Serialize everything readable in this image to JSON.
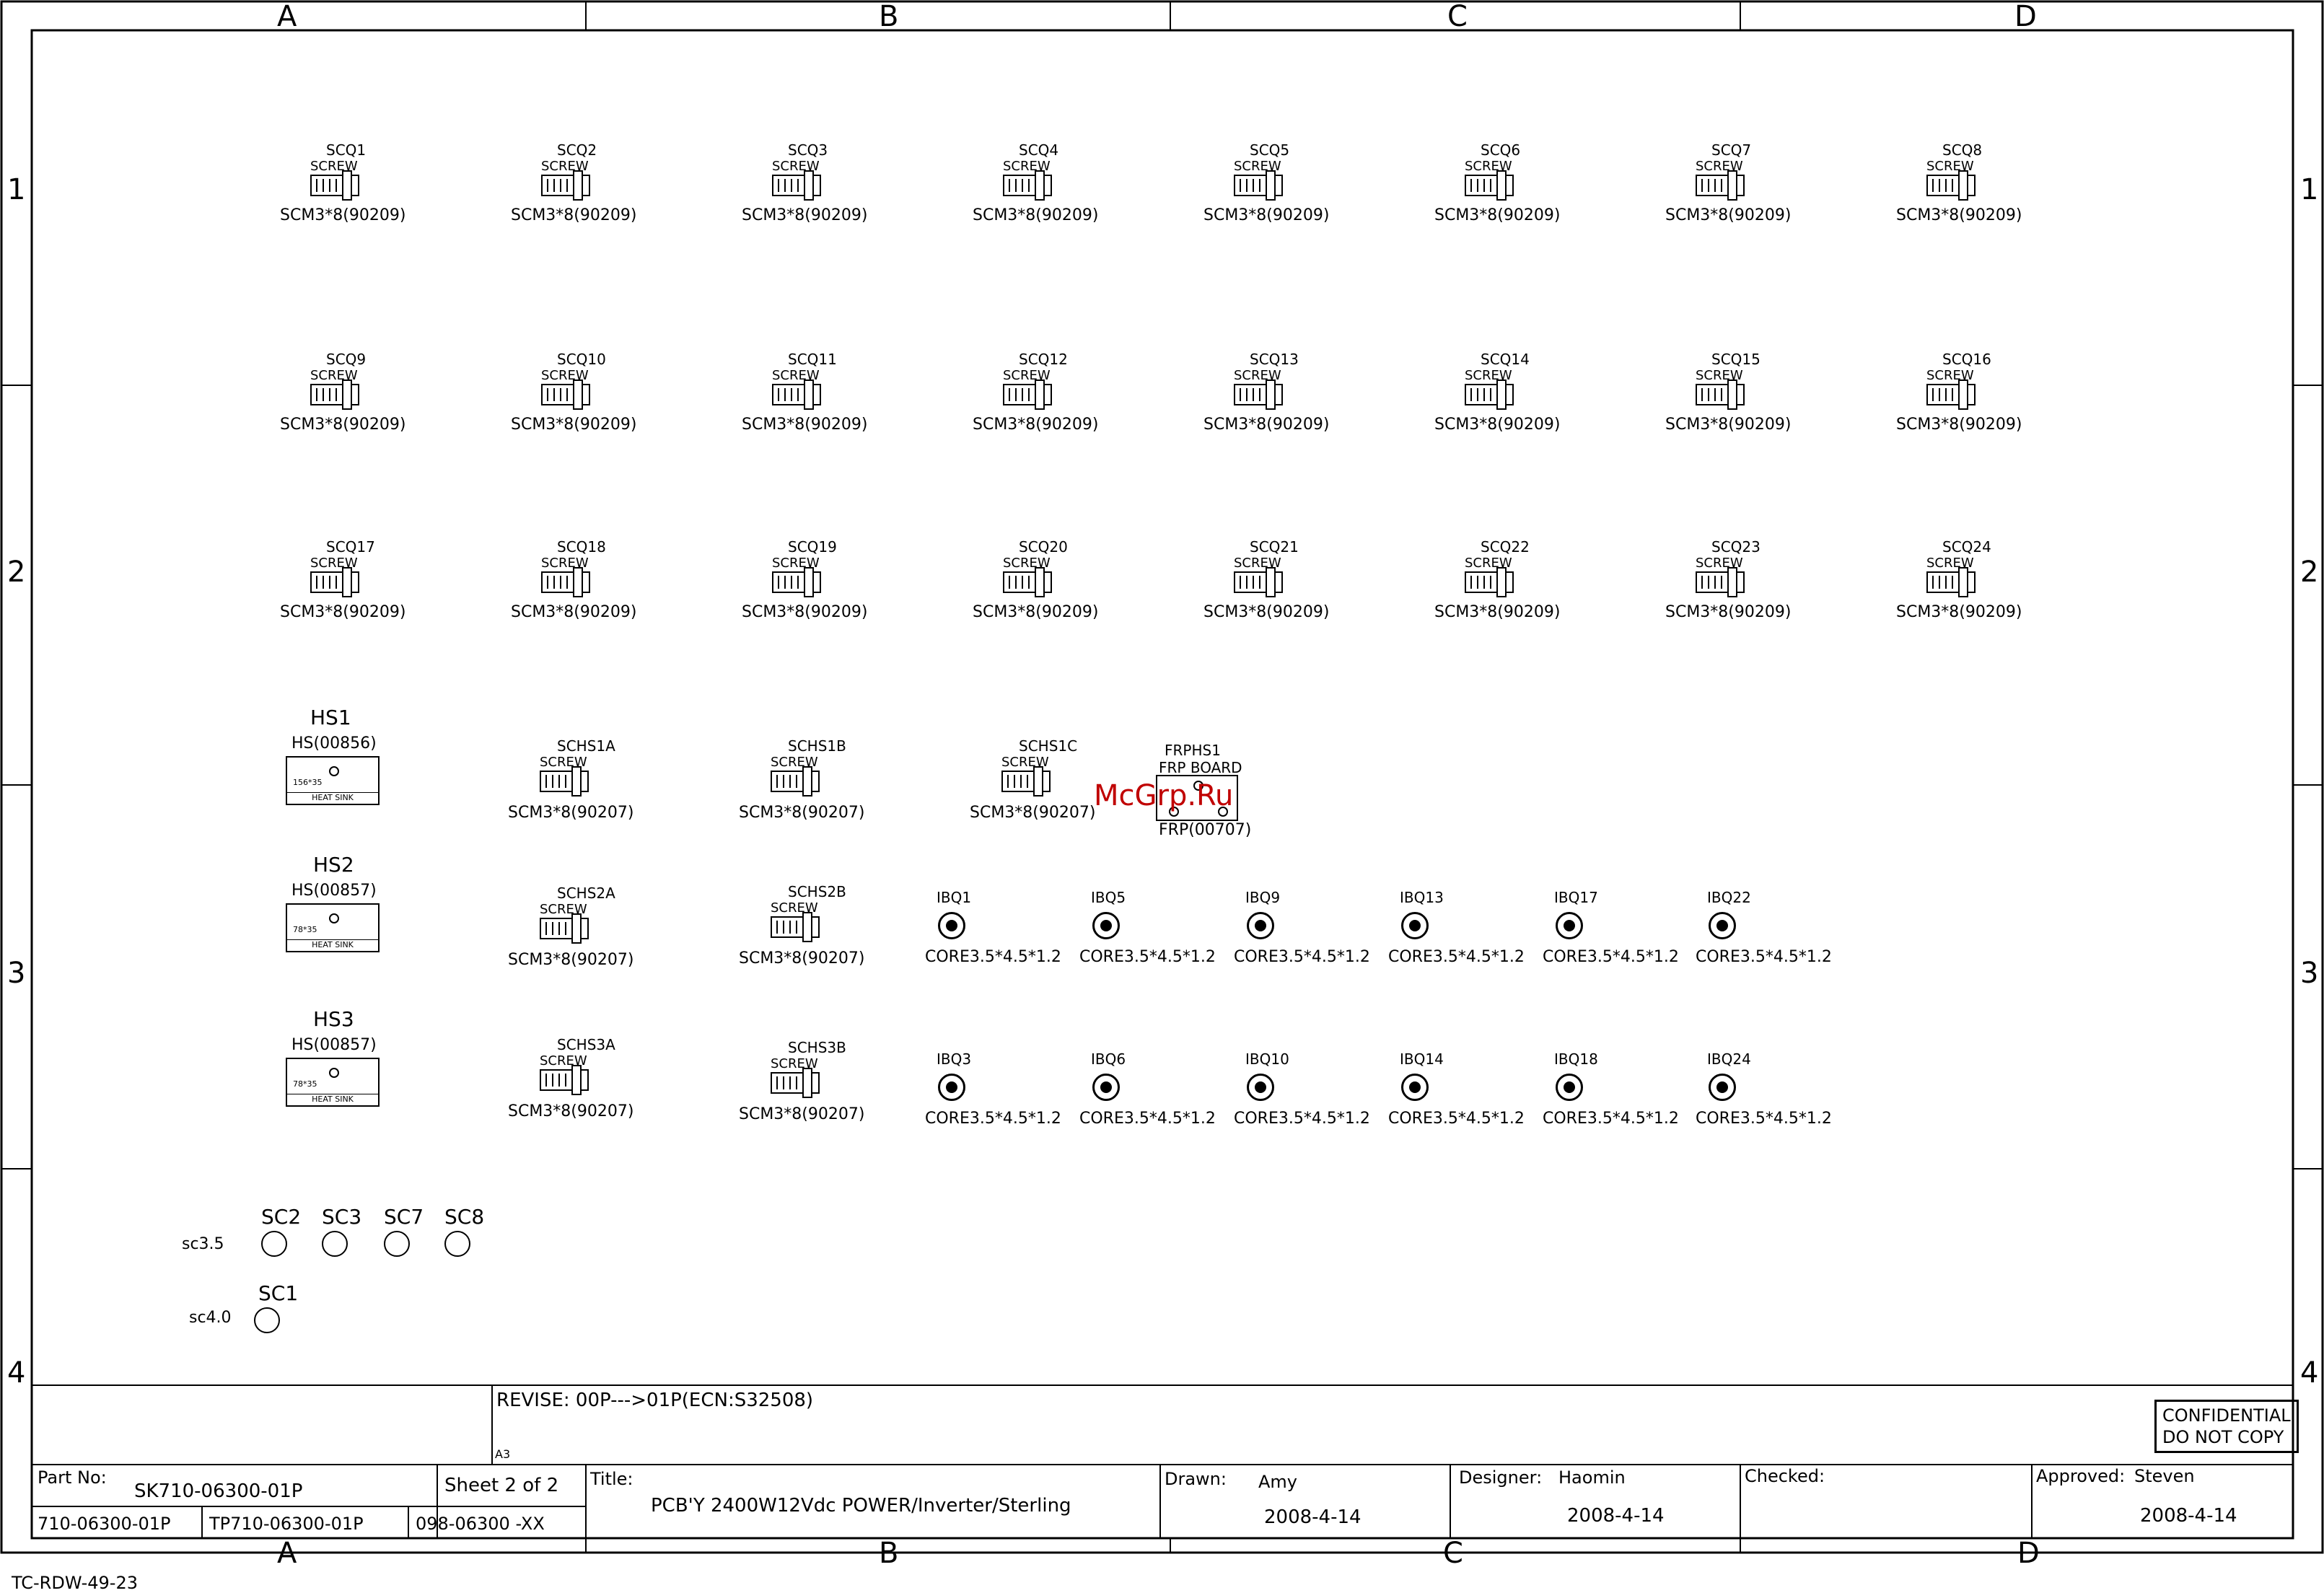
{
  "zones": {
    "columns": [
      "A",
      "B",
      "C",
      "D"
    ],
    "rows": [
      "1",
      "2",
      "3",
      "4"
    ]
  },
  "screws": [
    {
      "ref": "SCQ1",
      "type": "SCREW",
      "value": "SCM3*8(90209)"
    },
    {
      "ref": "SCQ2",
      "type": "SCREW",
      "value": "SCM3*8(90209)"
    },
    {
      "ref": "SCQ3",
      "type": "SCREW",
      "value": "SCM3*8(90209)"
    },
    {
      "ref": "SCQ4",
      "type": "SCREW",
      "value": "SCM3*8(90209)"
    },
    {
      "ref": "SCQ5",
      "type": "SCREW",
      "value": "SCM3*8(90209)"
    },
    {
      "ref": "SCQ6",
      "type": "SCREW",
      "value": "SCM3*8(90209)"
    },
    {
      "ref": "SCQ7",
      "type": "SCREW",
      "value": "SCM3*8(90209)"
    },
    {
      "ref": "SCQ8",
      "type": "SCREW",
      "value": "SCM3*8(90209)"
    },
    {
      "ref": "SCQ9",
      "type": "SCREW",
      "value": "SCM3*8(90209)"
    },
    {
      "ref": "SCQ10",
      "type": "SCREW",
      "value": "SCM3*8(90209)"
    },
    {
      "ref": "SCQ11",
      "type": "SCREW",
      "value": "SCM3*8(90209)"
    },
    {
      "ref": "SCQ12",
      "type": "SCREW",
      "value": "SCM3*8(90209)"
    },
    {
      "ref": "SCQ13",
      "type": "SCREW",
      "value": "SCM3*8(90209)"
    },
    {
      "ref": "SCQ14",
      "type": "SCREW",
      "value": "SCM3*8(90209)"
    },
    {
      "ref": "SCQ15",
      "type": "SCREW",
      "value": "SCM3*8(90209)"
    },
    {
      "ref": "SCQ16",
      "type": "SCREW",
      "value": "SCM3*8(90209)"
    },
    {
      "ref": "SCQ17",
      "type": "SCREW",
      "value": "SCM3*8(90209)"
    },
    {
      "ref": "SCQ18",
      "type": "SCREW",
      "value": "SCM3*8(90209)"
    },
    {
      "ref": "SCQ19",
      "type": "SCREW",
      "value": "SCM3*8(90209)"
    },
    {
      "ref": "SCQ20",
      "type": "SCREW",
      "value": "SCM3*8(90209)"
    },
    {
      "ref": "SCQ21",
      "type": "SCREW",
      "value": "SCM3*8(90209)"
    },
    {
      "ref": "SCQ22",
      "type": "SCREW",
      "value": "SCM3*8(90209)"
    },
    {
      "ref": "SCQ23",
      "type": "SCREW",
      "value": "SCM3*8(90209)"
    },
    {
      "ref": "SCQ24",
      "type": "SCREW",
      "value": "SCM3*8(90209)"
    },
    {
      "ref": "SCHS1A",
      "type": "SCREW",
      "value": "SCM3*8(90207)"
    },
    {
      "ref": "SCHS1B",
      "type": "SCREW",
      "value": "SCM3*8(90207)"
    },
    {
      "ref": "SCHS1C",
      "type": "SCREW",
      "value": "SCM3*8(90207)"
    },
    {
      "ref": "SCHS2A",
      "type": "SCREW",
      "value": "SCM3*8(90207)"
    },
    {
      "ref": "SCHS2B",
      "type": "SCREW",
      "value": "SCM3*8(90207)"
    },
    {
      "ref": "SCHS3A",
      "type": "SCREW",
      "value": "SCM3*8(90207)"
    },
    {
      "ref": "SCHS3B",
      "type": "SCREW",
      "value": "SCM3*8(90207)"
    }
  ],
  "heatsinks": [
    {
      "ref": "HS1",
      "value": "HS(00856)",
      "dim": "156*35",
      "caption": "HEAT SINK"
    },
    {
      "ref": "HS2",
      "value": "HS(00857)",
      "dim": "78*35",
      "caption": "HEAT SINK"
    },
    {
      "ref": "HS3",
      "value": "HS(00857)",
      "dim": "78*35",
      "caption": "HEAT SINK"
    }
  ],
  "frp": {
    "ref": "FRPHS1",
    "type": "FRP BOARD",
    "value": "FRP(00707)"
  },
  "cores": [
    {
      "ref": "IBQ1",
      "value": "CORE3.5*4.5*1.2"
    },
    {
      "ref": "IBQ5",
      "value": "CORE3.5*4.5*1.2"
    },
    {
      "ref": "IBQ9",
      "value": "CORE3.5*4.5*1.2"
    },
    {
      "ref": "IBQ13",
      "value": "CORE3.5*4.5*1.2"
    },
    {
      "ref": "IBQ17",
      "value": "CORE3.5*4.5*1.2"
    },
    {
      "ref": "IBQ22",
      "value": "CORE3.5*4.5*1.2"
    },
    {
      "ref": "IBQ3",
      "value": "CORE3.5*4.5*1.2"
    },
    {
      "ref": "IBQ6",
      "value": "CORE3.5*4.5*1.2"
    },
    {
      "ref": "IBQ10",
      "value": "CORE3.5*4.5*1.2"
    },
    {
      "ref": "IBQ14",
      "value": "CORE3.5*4.5*1.2"
    },
    {
      "ref": "IBQ18",
      "value": "CORE3.5*4.5*1.2"
    },
    {
      "ref": "IBQ24",
      "value": "CORE3.5*4.5*1.2"
    }
  ],
  "mounting_holes": {
    "sc35_label": "sc3.5",
    "sc40_label": "sc4.0",
    "sc35": [
      "SC2",
      "SC3",
      "SC7",
      "SC8"
    ],
    "sc40": [
      "SC1"
    ]
  },
  "watermark": "McGrp.Ru",
  "title_block": {
    "revise": "REVISE: 00P--->01P(ECN:S32508)",
    "sheet_size": "A3",
    "confidential": "CONFIDENTIAL",
    "do_not_copy": "DO NOT COPY",
    "part_no_label": "Part No:",
    "part_no": "SK710-06300-01P",
    "sheet": "Sheet  2 of 2",
    "title_label": "Title:",
    "title": "PCB'Y 2400W12Vdc POWER/Inverter/Sterling",
    "drawn_label": "Drawn:",
    "drawn_by": "Amy",
    "drawn_date": "2008-4-14",
    "designer_label": "Designer:",
    "designer": "Haomin",
    "designer_date": "2008-4-14",
    "checked_label": "Checked:",
    "approved_label": "Approved:",
    "approved_by": "Steven",
    "approved_date": "2008-4-14",
    "code1": "710-06300-01P",
    "code2": "TP710-06300-01P",
    "code3": "098-06300 -XX",
    "doc_code": "TC-RDW-49-23"
  }
}
